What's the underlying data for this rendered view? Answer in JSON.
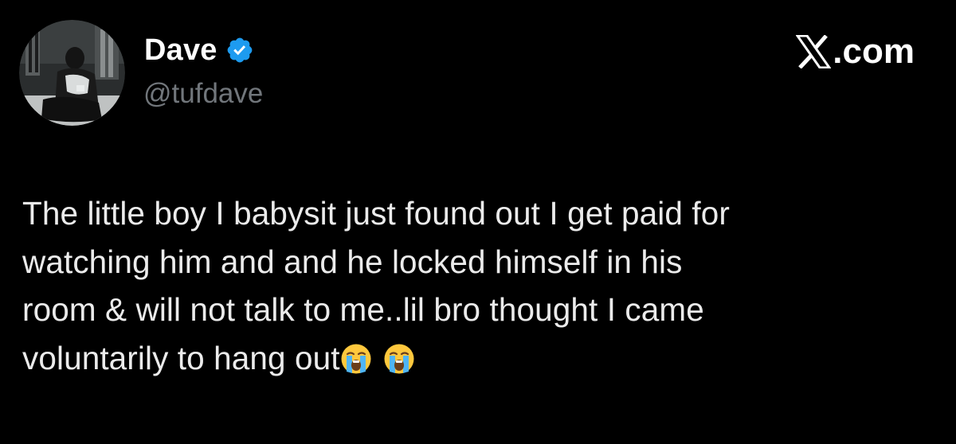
{
  "author": {
    "name": "Dave",
    "handle": "@tufdave",
    "verified": true,
    "verified_color": "#1d9bf0"
  },
  "brand": {
    "icon": "x-logo-icon",
    "text": ".com"
  },
  "tweet": {
    "lines": [
      "The little boy I babysit just found out I get paid for",
      "watching him and and he locked himself in his",
      "room & will not talk to me..lil bro thought I came",
      "voluntarily to hang out"
    ],
    "emojis": [
      "loudly-crying-face-icon",
      "loudly-crying-face-icon"
    ]
  },
  "colors": {
    "background": "#000000",
    "text": "#e7e9ea",
    "handle": "#71767b"
  }
}
